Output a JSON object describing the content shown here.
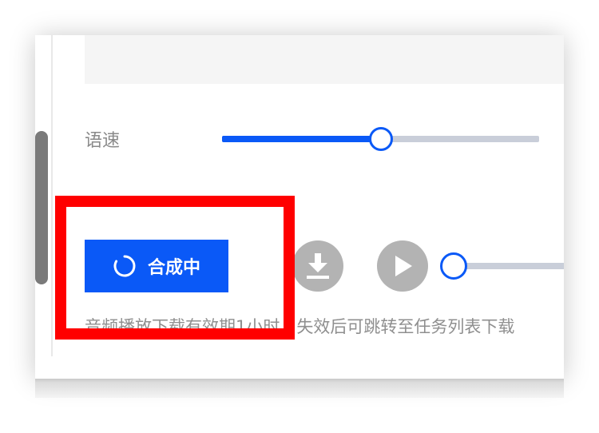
{
  "speed": {
    "label": "语速",
    "value_fraction": 0.5
  },
  "synthesize_button": {
    "label": "合成中",
    "loading": true
  },
  "player": {
    "progress_fraction": 0
  },
  "note": "音频播放下载有效期1小时，失效后可跳转至任务列表下载",
  "colors": {
    "accent": "#0a59f7",
    "highlight": "#ff0000",
    "icon_gray": "#b3b3b3"
  }
}
